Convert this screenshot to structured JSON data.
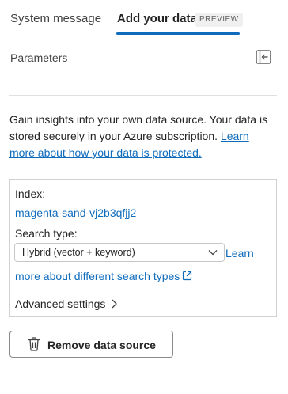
{
  "tabs": {
    "system_message": "System message",
    "add_your_data": "Add your data",
    "preview_badge": "PREVIEW"
  },
  "parameters": {
    "label": "Parameters",
    "panel_icon": "panel-collapse-icon"
  },
  "intro": {
    "text": "Gain insights into your own data source. Your data is stored securely in your Azure subscription. ",
    "link": "Learn more about how your data is protected."
  },
  "data_source": {
    "index_label": "Index:",
    "index_value": "magenta-sand-vj2b3qfjj2",
    "search_type_label": "Search type:",
    "search_type_value": "Hybrid (vector + keyword)",
    "learn_link_part1": "Learn",
    "learn_link_part2": "more about different search types",
    "advanced_settings": "Advanced settings"
  },
  "actions": {
    "remove_label": "Remove data source",
    "remove_icon": "trash-icon"
  },
  "colors": {
    "accent": "#0f6cbd",
    "text": "#242424",
    "border": "#d1d1d1"
  }
}
